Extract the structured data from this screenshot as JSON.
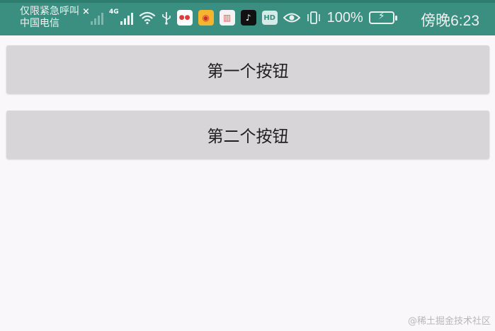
{
  "status_bar": {
    "emergency_text": "仅限紧急呼叫",
    "close_mark": "×",
    "carrier": "中国电信",
    "network_label": "4G",
    "hd_label": "HD",
    "battery_percent": "100%",
    "time": "傍晚6:23",
    "bg_color": "#3a8f80",
    "icons": [
      "signal-icon",
      "signal-icon",
      "wifi-icon",
      "usb-icon",
      "app-icon-1",
      "weibo-icon",
      "book-icon",
      "tiktok-icon",
      "hd-icon",
      "eye-icon",
      "vibrate-icon",
      "battery-icon"
    ]
  },
  "main": {
    "buttons": [
      {
        "label": "第一个按钮"
      },
      {
        "label": "第二个按钮"
      }
    ]
  },
  "watermark": "@稀土掘金技术社区"
}
